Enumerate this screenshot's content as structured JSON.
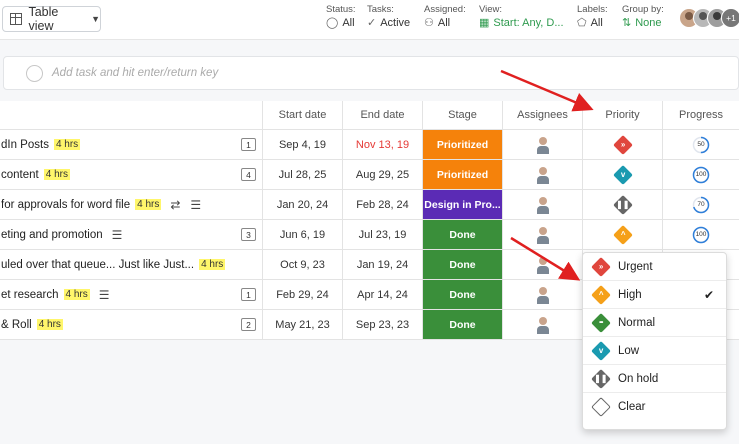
{
  "toolbar": {
    "view_button": "Table view",
    "filters": [
      {
        "label": "Status:",
        "value": "All",
        "icon": "check-circle-icon",
        "green": false
      },
      {
        "label": "Tasks:",
        "value": "Active",
        "icon": "check-icon",
        "green": false
      },
      {
        "label": "Assigned:",
        "value": "All",
        "icon": "people-icon",
        "green": false
      },
      {
        "label": "View:",
        "value": "Start: Any, D...",
        "icon": "calendar-icon",
        "green": true
      },
      {
        "label": "Labels:",
        "value": "All",
        "icon": "tag-icon",
        "green": false
      },
      {
        "label": "Group by:",
        "value": "None",
        "icon": "sort-icon",
        "green": true
      }
    ],
    "avatar_more": "+1"
  },
  "add_task": {
    "placeholder": "Add task and hit enter/return key"
  },
  "columns": {
    "start": "Start date",
    "end": "End date",
    "stage": "Stage",
    "assignees": "Assignees",
    "priority": "Priority",
    "progress": "Progress"
  },
  "rows": [
    {
      "name": "dIn Posts",
      "hrs": "4 hrs",
      "count": "1",
      "icons": [],
      "start": "Sep 4, 19",
      "end": "Nov 13, 19",
      "end_red": true,
      "stage": "Prioritized",
      "stage_color": "#f5820b",
      "priority": "urgent",
      "progress": 50
    },
    {
      "name": " content",
      "hrs": "4 hrs",
      "count": "4",
      "icons": [],
      "start": "Jul 28, 25",
      "end": "Aug 29, 25",
      "end_red": false,
      "stage": "Prioritized",
      "stage_color": "#f5820b",
      "priority": "low",
      "progress": 100
    },
    {
      "name": "for approvals for word file",
      "hrs": "4 hrs",
      "count": "",
      "icons": [
        "repeat-icon",
        "list-icon"
      ],
      "start": "Jan 20, 24",
      "end": "Feb 28, 24",
      "end_red": false,
      "stage": "Design in Pro...",
      "stage_color": "#5b2bb5",
      "priority": "onhold",
      "progress": 70
    },
    {
      "name": "eting and promotion",
      "hrs": "",
      "count": "3",
      "icons": [
        "list-icon"
      ],
      "start": "Jun 6, 19",
      "end": "Jul 23, 19",
      "end_red": false,
      "stage": "Done",
      "stage_color": "#3a8f3a",
      "priority": "high",
      "progress": 100
    },
    {
      "name": "uled over that queue... Just like Just...",
      "hrs": "4 hrs",
      "count": "",
      "icons": [],
      "start": "Oct 9, 23",
      "end": "Jan 19, 24",
      "end_red": false,
      "stage": "Done",
      "stage_color": "#3a8f3a",
      "priority": "",
      "progress": null
    },
    {
      "name": "et research",
      "hrs": "4 hrs",
      "count": "1",
      "icons": [
        "list-icon"
      ],
      "start": "Feb 29, 24",
      "end": "Apr 14, 24",
      "end_red": false,
      "stage": "Done",
      "stage_color": "#3a8f3a",
      "priority": "",
      "progress": null
    },
    {
      "name": "& Roll",
      "hrs": "4 hrs",
      "count": "2",
      "icons": [],
      "start": "May 21, 23",
      "end": "Sep 23, 23",
      "end_red": false,
      "stage": "Done",
      "stage_color": "#3a8f3a",
      "priority": "",
      "progress": null
    }
  ],
  "priority_menu": [
    {
      "key": "urgent",
      "label": "Urgent",
      "color": "#e0463d",
      "symbol": "︽",
      "checked": false
    },
    {
      "key": "high",
      "label": "High",
      "color": "#f5a019",
      "symbol": "︿",
      "checked": true
    },
    {
      "key": "normal",
      "label": "Normal",
      "color": "#3a8f3a",
      "symbol": "•••",
      "checked": false
    },
    {
      "key": "low",
      "label": "Low",
      "color": "#1a9ab0",
      "symbol": "﹀",
      "checked": false
    },
    {
      "key": "onhold",
      "label": "On hold",
      "color": "#666666",
      "symbol": "❚❚",
      "checked": false
    },
    {
      "key": "clear",
      "label": "Clear",
      "color": "#ffffff",
      "symbol": "",
      "checked": false
    }
  ],
  "colors": {
    "arrow": "#e02020",
    "accent_green": "#2e9a4e",
    "progress_ring": "#2f7fd9"
  }
}
